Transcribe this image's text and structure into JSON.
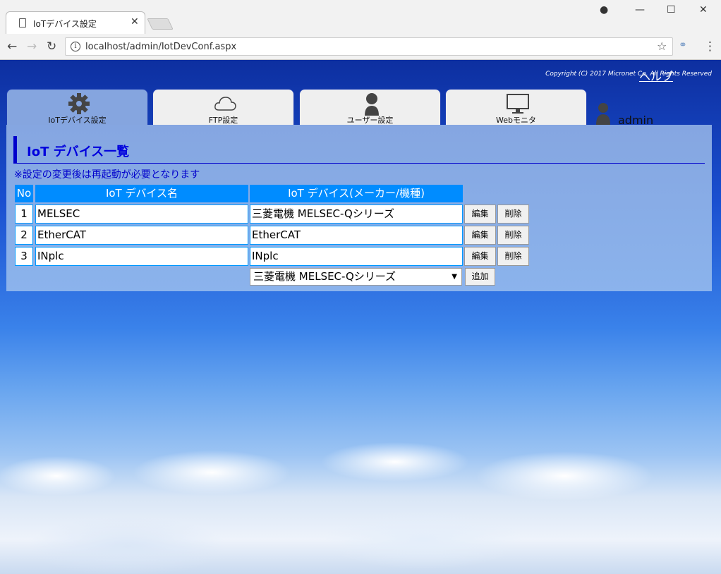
{
  "browser": {
    "tab_title": "IoTデバイス設定",
    "url": "localhost/admin/IotDevConf.aspx"
  },
  "header": {
    "help": "ヘルプ",
    "copyright": "Copyright (C) 2017 Micronet Co. All Rights Reserved"
  },
  "tabs": [
    {
      "label": "IoTデバイス設定",
      "icon": "gear-icon"
    },
    {
      "label": "FTP設定",
      "icon": "cloud-icon"
    },
    {
      "label": "ユーザー設定",
      "icon": "user-icon"
    },
    {
      "label": "Webモニタ",
      "icon": "monitor-icon"
    }
  ],
  "user": {
    "name": "admin"
  },
  "section": {
    "title": "IoT デバイス一覧",
    "note": "※設定の変更後は再起動が必要となります"
  },
  "table": {
    "headers": [
      "No",
      "IoT デバイス名",
      "IoT デバイス(メーカー/機種)"
    ],
    "rows": [
      {
        "no": "1",
        "name": "MELSEC",
        "type": "三菱電機 MELSEC-Qシリーズ"
      },
      {
        "no": "2",
        "name": "EtherCAT",
        "type": "EtherCAT"
      },
      {
        "no": "3",
        "name": "INplc",
        "type": "INplc"
      }
    ],
    "edit_label": "編集",
    "delete_label": "削除"
  },
  "add": {
    "selected": "三菱電機 MELSEC-Qシリーズ",
    "button": "追加"
  }
}
